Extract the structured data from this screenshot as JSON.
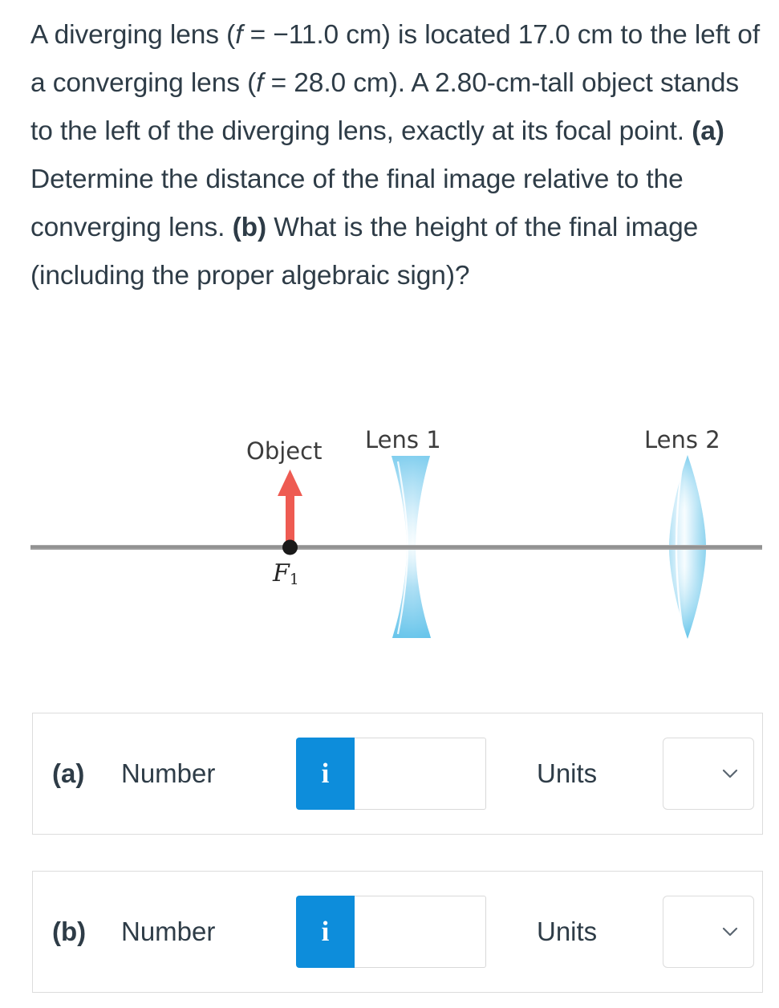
{
  "problem": {
    "full_text": "A diverging lens (f = −11.0 cm) is located 17.0 cm to the left of a converging lens (f = 28.0 cm). A 2.80-cm-tall object stands to the left of the diverging lens, exactly at its focal point. (a) Determine the distance of the final image relative to the converging lens. (b) What is the height of the final image (including the proper algebraic sign)?",
    "diverging_focal_length": "−11.0 cm",
    "separation": "17.0 cm",
    "converging_focal_length": "28.0 cm",
    "object_height": "2.80-cm-tall",
    "segments": {
      "s1": "A diverging lens (",
      "f1": "f",
      "s2": " = −11.0 cm) is located 17.0 cm to the left of a converging lens (",
      "f2": "f",
      "s3": " = 28.0 cm). A 2.80-cm-tall object stands to the left of the diverging lens, exactly at its focal point. ",
      "a_tag": "(a)",
      "s4": " Determine the distance of the final image relative to the converging lens. ",
      "b_tag": "(b)",
      "s5": " What is the height of the final image (including the proper algebraic sign)?"
    }
  },
  "diagram": {
    "object_label": "Object",
    "lens1_label": "Lens 1",
    "lens2_label": "Lens 2",
    "focal_point_label": "F",
    "focal_point_sub": "1",
    "colors": {
      "object_arrow": "#ee5b52",
      "lens_glass": "#8ed8f3",
      "lens_glass_light": "#e8f7fd",
      "axis": "#8c8c8c",
      "focal_dot": "#1a1a1a",
      "label_text": "#3c3c3c"
    },
    "lens1_type": "diverging-biconcave",
    "lens2_type": "converging-biconvex"
  },
  "answers": [
    {
      "id": "a",
      "part_label": "(a)",
      "number_label": "Number",
      "info_icon": "i",
      "number_value": "",
      "number_placeholder": "",
      "units_label": "Units",
      "units_value": "",
      "chevron_icon": "chevron-down-icon"
    },
    {
      "id": "b",
      "part_label": "(b)",
      "number_label": "Number",
      "info_icon": "i",
      "number_value": "",
      "number_placeholder": "",
      "units_label": "Units",
      "units_value": "",
      "chevron_icon": "chevron-down-icon"
    }
  ],
  "theme": {
    "accent_blue": "#0d8ddb",
    "text": "#2e3c47",
    "border": "#dcdcdc"
  }
}
